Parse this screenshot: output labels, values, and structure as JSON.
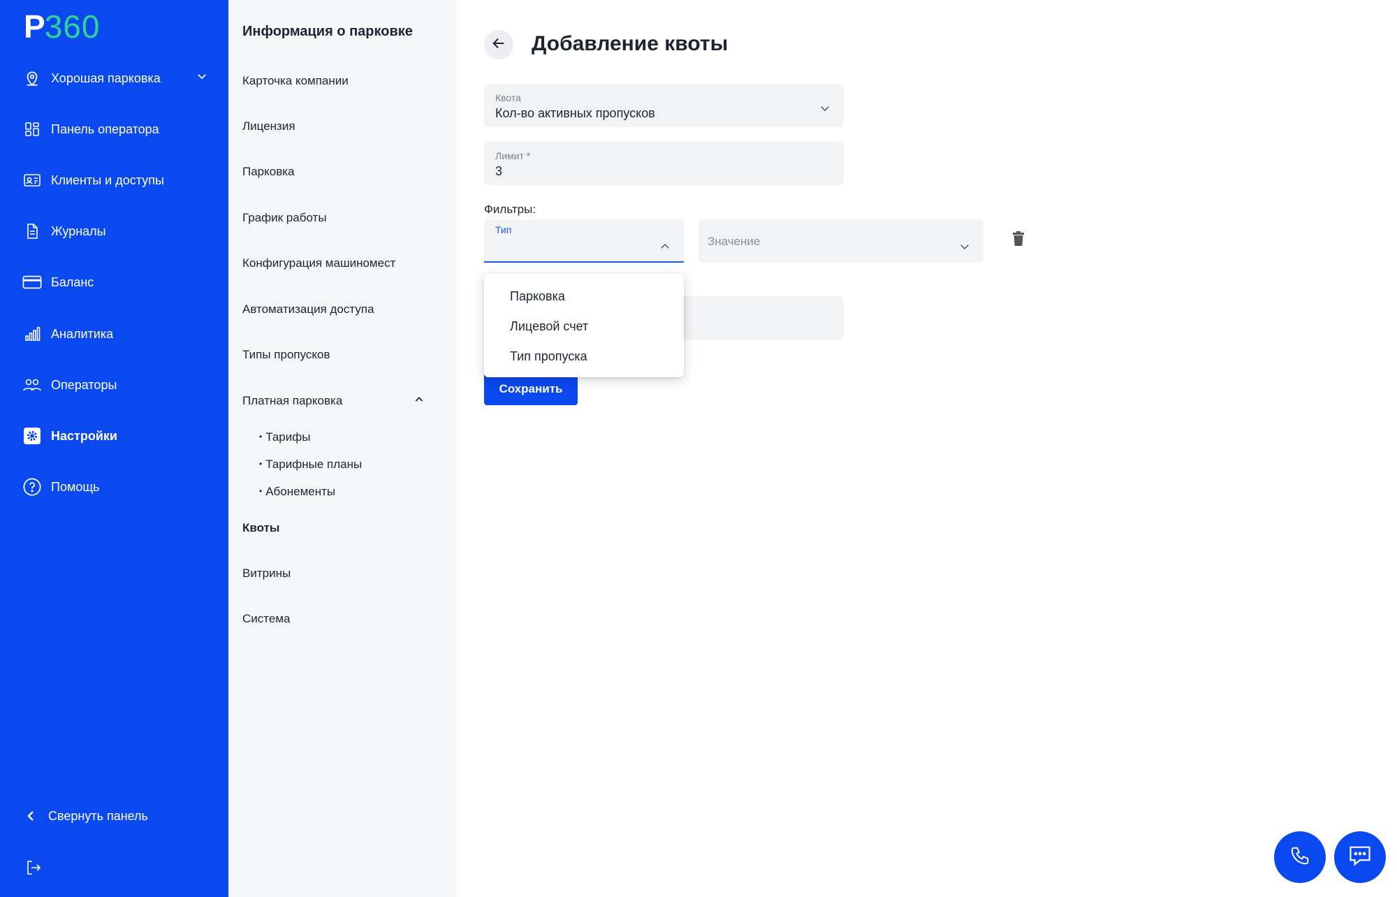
{
  "brand": {
    "letter": "P",
    "number": "360"
  },
  "sidebar": {
    "items": [
      {
        "label": "Хорошая парковка",
        "icon": "location-pin-icon"
      },
      {
        "label": "Панель оператора",
        "icon": "dashboard-icon"
      },
      {
        "label": "Клиенты и доступы",
        "icon": "id-card-icon"
      },
      {
        "label": "Журналы",
        "icon": "document-icon"
      },
      {
        "label": "Баланс",
        "icon": "credit-card-icon"
      },
      {
        "label": "Аналитика",
        "icon": "bar-chart-icon"
      },
      {
        "label": "Операторы",
        "icon": "users-icon"
      },
      {
        "label": "Настройки",
        "icon": "gear-icon"
      },
      {
        "label": "Помощь",
        "icon": "help-icon"
      }
    ],
    "collapse_label": "Свернуть панель"
  },
  "subnav": {
    "heading": "Информация о парковке",
    "items": [
      "Карточка компании",
      "Лицензия",
      "Парковка",
      "График работы",
      "Конфигурация машиномест",
      "Автоматизация доступа",
      "Типы пропусков",
      "Платная парковка"
    ],
    "children": [
      "Тарифы",
      "Тарифные планы",
      "Абонементы"
    ],
    "after": [
      "Квоты",
      "Витрины",
      "Система"
    ]
  },
  "page": {
    "title": "Добавление квоты",
    "quota": {
      "label": "Квота",
      "value": "Кол-во активных пропусков"
    },
    "limit": {
      "label": "Лимит *",
      "value": "3"
    },
    "filters_label": "Фильтры:",
    "type_label": "Тип",
    "value_placeholder": "Значение",
    "save_label": "Сохранить",
    "dropdown_options": [
      "Парковка",
      "Лицевой счет",
      "Тип пропуска"
    ]
  },
  "colors": {
    "brand_blue": "#0a48f0",
    "accent_green": "#2fd39a"
  }
}
